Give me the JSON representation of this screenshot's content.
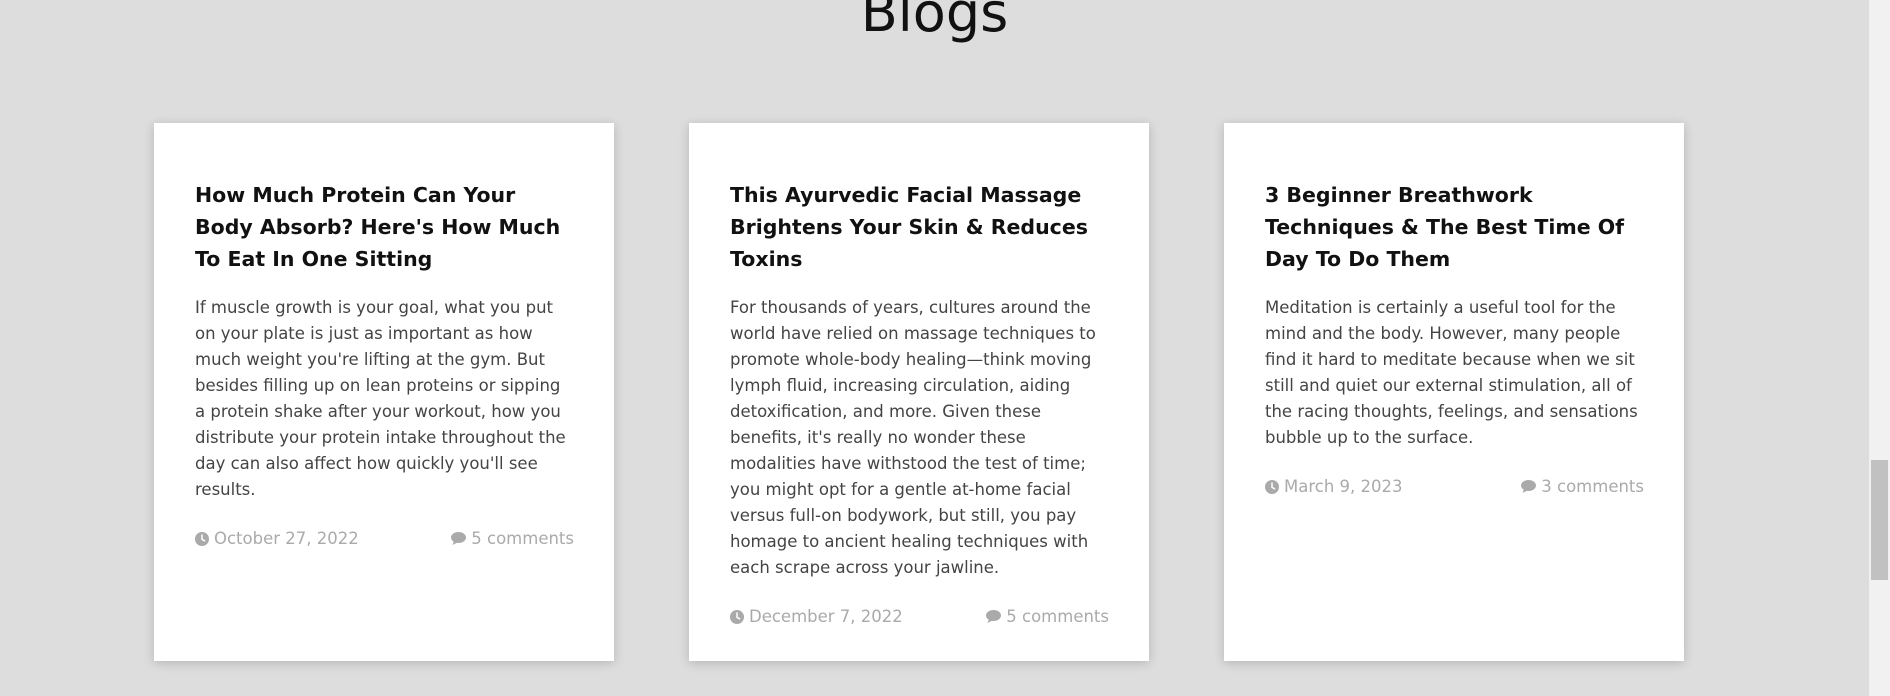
{
  "section": {
    "title": "Blogs"
  },
  "posts": [
    {
      "title": "How Much Protein Can Your Body Absorb? Here's How Much To Eat In One Sitting",
      "excerpt": "If muscle growth is your goal, what you put on your plate is just as important as how much weight you're lifting at the gym. But besides filling up on lean proteins or sipping a protein shake after your workout, how you distribute your protein intake throughout the day can also affect how quickly you'll see results.",
      "date": "October 27, 2022",
      "comments": "5 comments"
    },
    {
      "title": "This Ayurvedic Facial Massage Brightens Your Skin & Reduces Toxins",
      "excerpt": "For thousands of years, cultures around the world have relied on massage techniques to promote whole-body healing—think moving lymph fluid, increasing circulation, aiding detoxification, and more. Given these benefits, it's really no wonder these modalities have withstood the test of time; you might opt for a gentle at-home facial versus full-on bodywork, but still, you pay homage to ancient healing techniques with each scrape across your jawline.",
      "date": "December 7, 2022",
      "comments": "5 comments"
    },
    {
      "title": "3 Beginner Breathwork Techniques & The Best Time Of Day To Do Them",
      "excerpt": "Meditation is certainly a useful tool for the mind and the body. However, many people find it hard to meditate because when we sit still and quiet our external stimulation, all of the racing thoughts, feelings, and sensations bubble up to the surface.",
      "date": "March 9, 2023",
      "comments": "3 comments"
    }
  ],
  "icons": {
    "date": "clock-icon",
    "comments": "comment-icon"
  },
  "colors": {
    "background": "#dddddd",
    "card": "#ffffff",
    "title": "#111111",
    "body_text": "#444444",
    "meta_text": "#aaaaaa"
  }
}
